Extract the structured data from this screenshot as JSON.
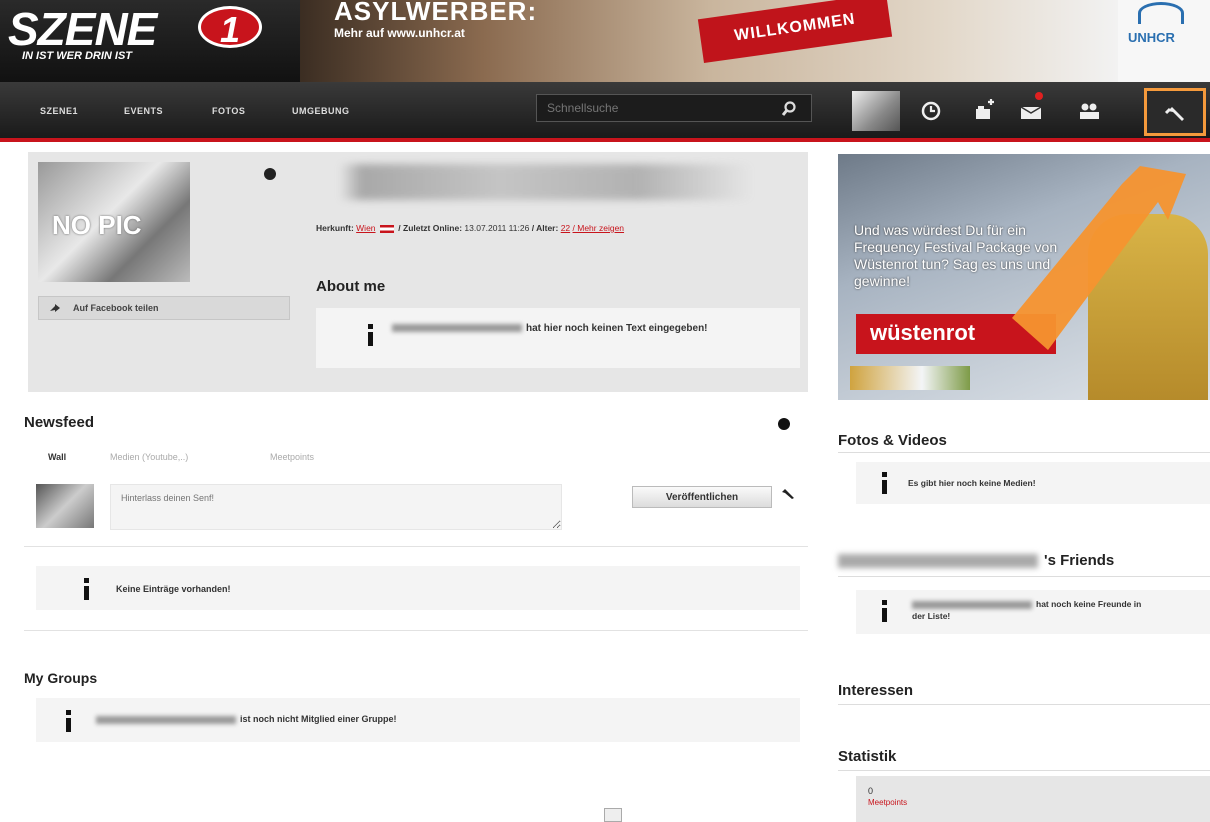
{
  "header": {
    "logo_text": "SZENE",
    "logo_number": "1",
    "logo_tagline": "IN IST WER DRIN IST",
    "ad_headline": "ASYLWERBER:",
    "ad_subline": "Mehr auf www.unhcr.at",
    "ad_sign": "WILLKOMMEN",
    "ad_sponsor": "UNHCR"
  },
  "nav": {
    "items": [
      "SZENE1",
      "EVENTS",
      "FOTOS",
      "UMGEBUNG"
    ],
    "search_placeholder": "Schnellsuche",
    "icons": [
      "search-icon",
      "clock-icon",
      "friend-request-icon",
      "mail-icon",
      "users-icon",
      "wrench-icon"
    ],
    "accent_color": "#c8141c"
  },
  "profile": {
    "no_pic_label": "NO PIC",
    "facebook_share": "Auf Facebook teilen",
    "origin_label": "Herkunft:",
    "origin_value": "Wien",
    "last_online_label": "/ Zuletzt Online:",
    "last_online_value": "13.07.2011 11:26",
    "age_label": "/ Alter:",
    "age_value": "22",
    "more_link": "/ Mehr zeigen",
    "about_title": "About me",
    "about_text": "hat hier noch keinen Text eingegeben!"
  },
  "newsfeed": {
    "title": "Newsfeed",
    "tabs": [
      "Wall",
      "Medien (Youtube,..)",
      "Meetpoints"
    ],
    "post_placeholder": "Hinterlass deinen Senf!",
    "publish_label": "Veröffentlichen",
    "empty_text": "Keine Einträge vorhanden!"
  },
  "groups": {
    "title": "My Groups",
    "empty_text": "ist noch nicht Mitglied einer Gruppe!"
  },
  "sidebar": {
    "promo_text": "Und was würdest Du für ein Frequency Festival Package von Wüstenrot tun? Sag es uns und gewinne!",
    "promo_brand": "wüstenrot",
    "fotos_title": "Fotos & Videos",
    "fotos_empty": "Es gibt hier noch keine Medien!",
    "friends_title": "'s Friends",
    "friends_empty": "hat noch keine Freunde in der Liste!",
    "interessen_title": "Interessen",
    "statistik_title": "Statistik",
    "stat_value": "0",
    "stat_label": "Meetpoints"
  }
}
